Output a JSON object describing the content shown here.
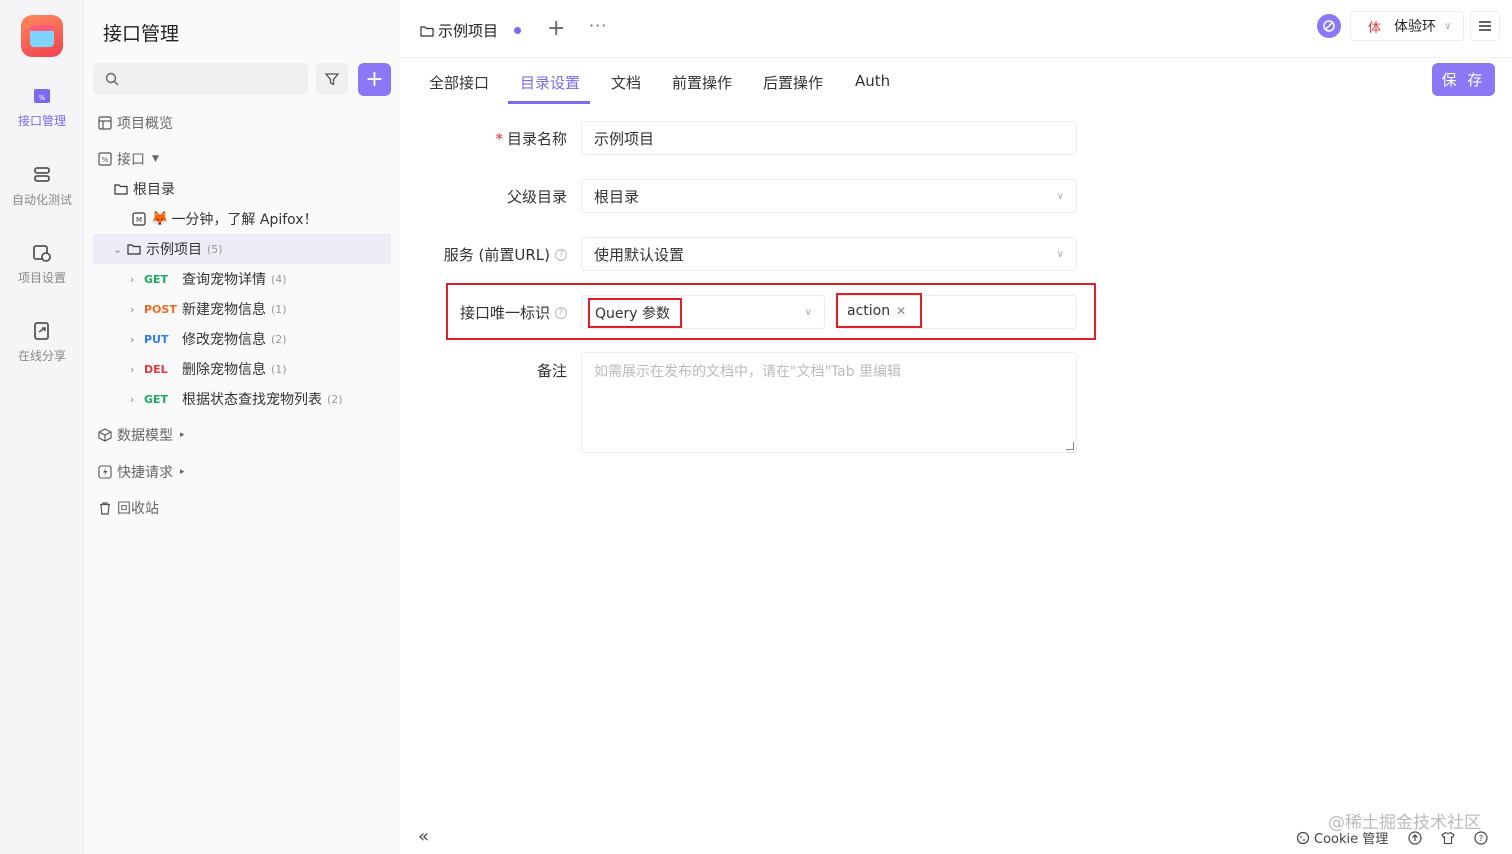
{
  "rail": {
    "items": [
      {
        "label": "接口管理",
        "icon": "api-icon"
      },
      {
        "label": "自动化测试",
        "icon": "automation-icon"
      },
      {
        "label": "项目设置",
        "icon": "settings-icon"
      },
      {
        "label": "在线分享",
        "icon": "share-icon"
      }
    ]
  },
  "sidebar": {
    "title": "接口管理",
    "overview": "项目概览",
    "api": "接口",
    "root": "根目录",
    "intro": "一分钟，了解 Apifox！",
    "folder": {
      "label": "示例项目",
      "count": "(5)"
    },
    "endpoints": [
      {
        "method": "GET",
        "label": "查询宠物详情",
        "count": "(4)"
      },
      {
        "method": "POST",
        "label": "新建宠物信息",
        "count": "(1)"
      },
      {
        "method": "PUT",
        "label": "修改宠物信息",
        "count": "(2)"
      },
      {
        "method": "DEL",
        "label": "删除宠物信息",
        "count": "(1)"
      },
      {
        "method": "GET",
        "label": "根据状态查找宠物列表",
        "count": "(2)"
      }
    ],
    "models": "数据模型",
    "quick": "快捷请求",
    "trash": "回收站"
  },
  "header": {
    "tab_title": "示例项目",
    "env_badge": "体",
    "env_name": "体验环",
    "save": "保 存"
  },
  "subtabs": [
    "全部接口",
    "目录设置",
    "文档",
    "前置操作",
    "后置操作",
    "Auth"
  ],
  "form": {
    "name_label": "目录名称",
    "name_value": "示例项目",
    "parent_label": "父级目录",
    "parent_value": "根目录",
    "service_label": "服务 (前置URL)",
    "service_value": "使用默认设置",
    "unique_label": "接口唯一标识",
    "unique_type": "Query 参数",
    "unique_tag": "action",
    "note_label": "备注",
    "note_placeholder": "如需展示在发布的文档中，请在\"文档\"Tab 里编辑"
  },
  "footer": {
    "cookie": "Cookie 管理",
    "watermark": "@稀土掘金技术社区"
  }
}
